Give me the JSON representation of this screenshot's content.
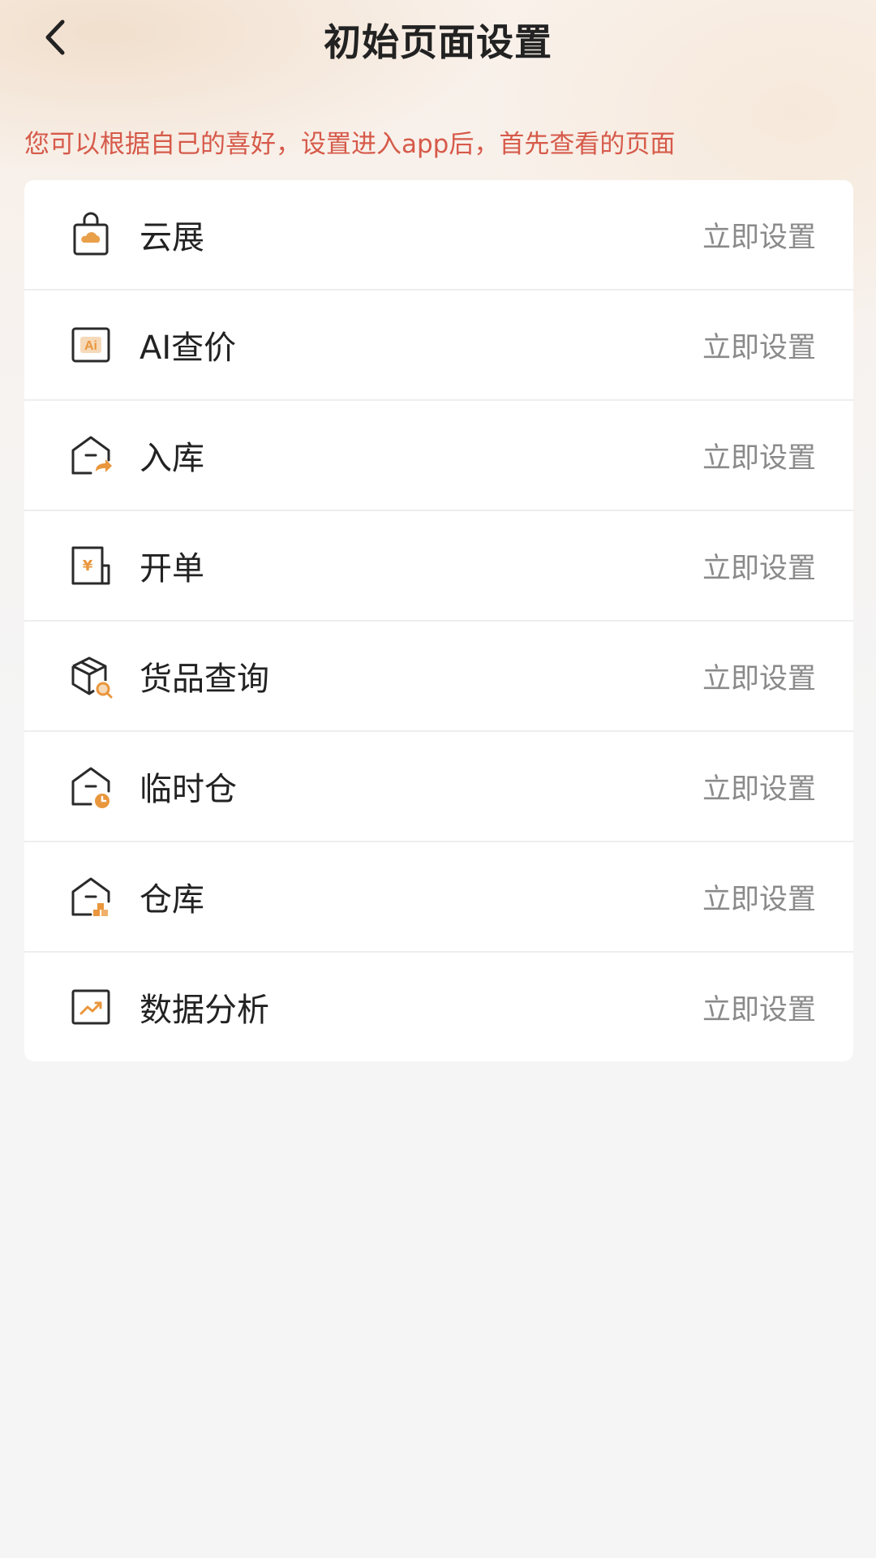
{
  "header": {
    "title": "初始页面设置",
    "back_icon": "chevron-left-icon"
  },
  "tip": "您可以根据自己的喜好，设置进入app后，首先查看的页面",
  "colors": {
    "tip_red": "#d65a4a",
    "accent_orange": "#e9963c",
    "text_dark": "#222222",
    "text_gray": "#8a8a8a"
  },
  "items": [
    {
      "label": "云展",
      "action": "立即设置",
      "icon": "shopping-bag-cloud-icon"
    },
    {
      "label": "AI查价",
      "action": "立即设置",
      "icon": "ai-badge-icon"
    },
    {
      "label": "入库",
      "action": "立即设置",
      "icon": "warehouse-inbound-icon"
    },
    {
      "label": "开单",
      "action": "立即设置",
      "icon": "invoice-yuan-icon"
    },
    {
      "label": "货品查询",
      "action": "立即设置",
      "icon": "box-search-icon"
    },
    {
      "label": "临时仓",
      "action": "立即设置",
      "icon": "warehouse-clock-icon"
    },
    {
      "label": "仓库",
      "action": "立即设置",
      "icon": "warehouse-boxes-icon"
    },
    {
      "label": "数据分析",
      "action": "立即设置",
      "icon": "chart-trend-icon"
    }
  ]
}
